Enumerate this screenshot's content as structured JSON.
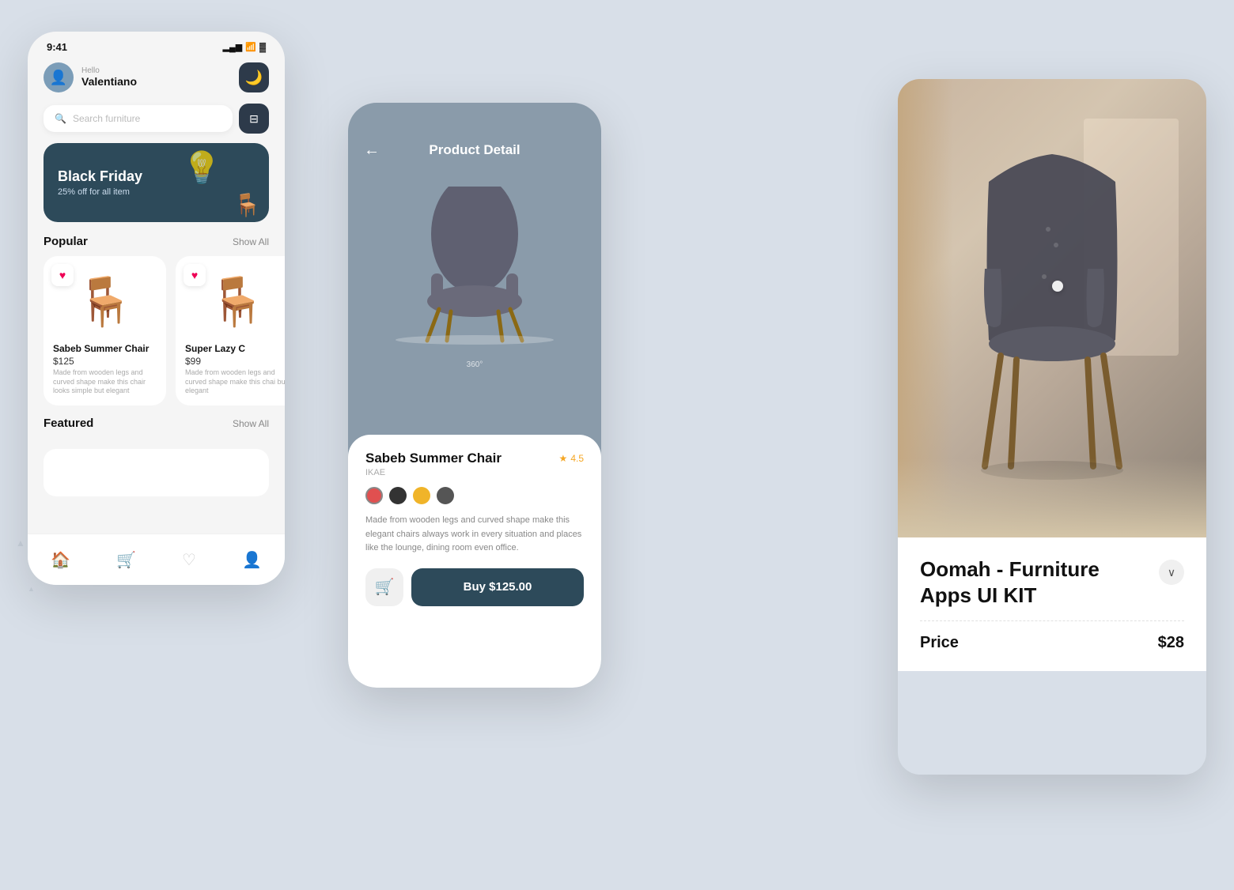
{
  "bg": {
    "color": "#d8dfe8"
  },
  "phone_left": {
    "status": {
      "time": "9:41",
      "signal": "▂▄▆",
      "wifi": "wifi",
      "battery": "🔋"
    },
    "header": {
      "hello": "Hello",
      "user": "Valentiano"
    },
    "search": {
      "placeholder": "Search furniture"
    },
    "banner": {
      "title": "Black Friday",
      "subtitle": "25% off for all item"
    },
    "popular": {
      "label": "Popular",
      "show_all": "Show All"
    },
    "products": [
      {
        "name": "Sabeb Summer Chair",
        "price": "$125",
        "desc": "Made from wooden legs and curved shape make this chair looks simple but elegant"
      },
      {
        "name": "Super Lazy C",
        "price": "$99",
        "desc": "Made from wooden legs and curved shape make this chai but elegant"
      }
    ],
    "featured": {
      "label": "Featured",
      "show_all": "Show All"
    },
    "nav": [
      "home",
      "cart",
      "heart",
      "profile"
    ]
  },
  "phone_mid": {
    "title": "Product Detail",
    "view_360": "360°",
    "product": {
      "name": "Sabeb Summer Chair",
      "brand": "IKAE",
      "rating": "4.5",
      "colors": [
        "#e05050",
        "#333",
        "#f0b429",
        "#555"
      ],
      "description": "Made from wooden legs and curved shape make this elegant chairs always work in every situation and places like the lounge, dining room even office.",
      "price": "125.00"
    },
    "buy_button": "Buy $125.00"
  },
  "right_panel": {
    "title": "Oomah - Furniture\nApps UI KIT",
    "price_label": "Price",
    "price_value": "$28"
  }
}
